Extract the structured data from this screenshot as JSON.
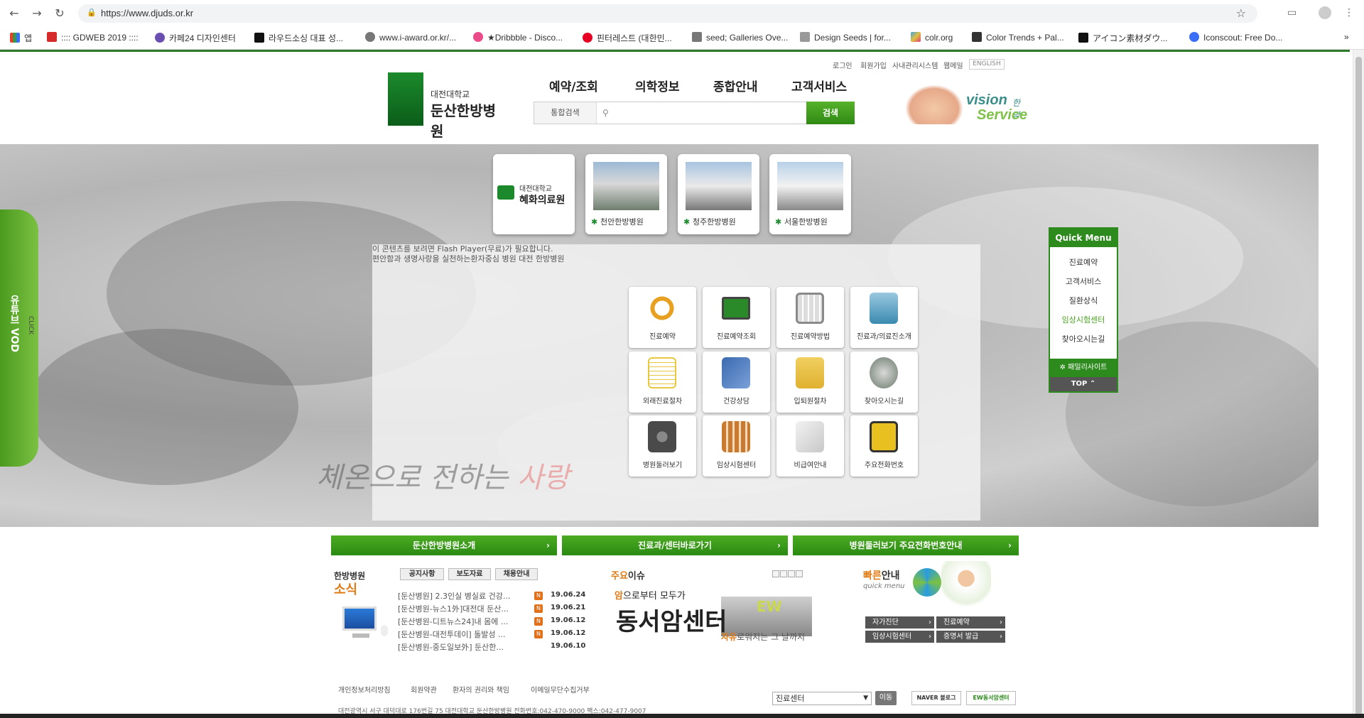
{
  "browser": {
    "url": "https://www.djuds.or.kr",
    "bookmarks": [
      {
        "label": "앱",
        "color": "#e3402e"
      },
      {
        "label": ":::: GDWEB 2019 ::::",
        "color": "#d62b2b"
      },
      {
        "label": "카페24 디자인센터",
        "color": "#6b4fb0"
      },
      {
        "label": "라우드소싱 대표 성...",
        "color": "#111111"
      },
      {
        "label": "www.i-award.or.kr/...",
        "color": "#555555"
      },
      {
        "label": "★Dribbble - Disco...",
        "color": "#ea4c89"
      },
      {
        "label": "핀터레스트 (대한민...",
        "color": "#e60023"
      },
      {
        "label": "seed; Galleries Ove...",
        "color": "#777777"
      },
      {
        "label": "Design Seeds | for...",
        "color": "#999999"
      },
      {
        "label": "colr.org",
        "color": "#3fa0e0"
      },
      {
        "label": "Color Trends + Pal...",
        "color": "#333333"
      },
      {
        "label": "アイコン素材ダウ...",
        "color": "#111111"
      },
      {
        "label": "Iconscout: Free Do...",
        "color": "#3b6ef6"
      }
    ]
  },
  "util": {
    "login": "로그인",
    "join": "회원가입",
    "intranet": "사내관리시스템",
    "webmail": "웹메일",
    "english": "ENGLISH"
  },
  "logo": {
    "line1": "대전대학교",
    "line2": "둔산한방병원"
  },
  "gnb": [
    "예약/조회",
    "의학정보",
    "종합안내",
    "고객서비스"
  ],
  "search": {
    "scope": "통합검색",
    "button": "검색",
    "value": ""
  },
  "vision": {
    "word1": "vision",
    "word1b": "한방",
    "word2": "Service"
  },
  "vod": {
    "label": "유튜브 VOD",
    "click": "CLICK"
  },
  "branches": [
    {
      "pre": "대전대학교",
      "name": "혜화의료원"
    },
    {
      "name": "천안한방병원"
    },
    {
      "name": "청주한방병원"
    },
    {
      "name": "서울한방병원"
    }
  ],
  "flash": {
    "line1": "이 콘텐츠를 보려면 Flash Player(무료)가 필요합니다.",
    "line2": "편안함과 생명사랑을 실천하는환자중심 병원 대전 한방병원"
  },
  "services": [
    {
      "label": "진료예약",
      "color": "#e8a020"
    },
    {
      "label": "진료예약조회",
      "color": "#2a8a2a"
    },
    {
      "label": "진료예약방법",
      "color": "#8a8a8a"
    },
    {
      "label": "진료과/의료진소개",
      "color": "#3a8ab0"
    },
    {
      "label": "외래진료절차",
      "color": "#e8c840"
    },
    {
      "label": "건강상담",
      "color": "#3a6ab0"
    },
    {
      "label": "입퇴원절차",
      "color": "#e0b030"
    },
    {
      "label": "찾아오시는길",
      "color": "#6a7a6a"
    },
    {
      "label": "병원둘러보기",
      "color": "#4a4a4a"
    },
    {
      "label": "임상시험센터",
      "color": "#c87a30"
    },
    {
      "label": "비급여안내",
      "color": "#d0d0d0"
    },
    {
      "label": "주요전화번호",
      "color": "#e8c020"
    }
  ],
  "slogan": {
    "main": "체온으로 전하는 ",
    "accent": "사랑"
  },
  "quick": {
    "title": "Quick Menu",
    "items": [
      "진료예약",
      "고객서비스",
      "질환상식",
      "임상시험센터",
      "찾아오시는길"
    ],
    "family": "패밀리사이트",
    "top": "TOP ⌃"
  },
  "bars": [
    "둔산한방병원소개",
    "진료과/센터바로가기",
    "병원둘러보기 주요전화번호안내"
  ],
  "news": {
    "heading1": "한방병원",
    "heading2": "소식",
    "tabs": [
      "공지사항",
      "보도자료",
      "채용안내"
    ],
    "items": [
      {
        "title": "[둔산병원] 2.3인실 병실료 건강...",
        "date": "19.06.24"
      },
      {
        "title": "[둔산병원-뉴스1外]대전대 둔산...",
        "date": "19.06.21"
      },
      {
        "title": "[둔산병원-디트뉴스24]내 몸에 ...",
        "date": "19.06.12"
      },
      {
        "title": "[둔산병원-대전투데이] 돌발성 ...",
        "date": "19.06.12"
      },
      {
        "title": "[둔산병원-중도일보外] 둔산한...",
        "date": "19.06.10"
      }
    ]
  },
  "issue": {
    "heading1": "주요",
    "heading2": "이슈",
    "line1a": "암",
    "line1b": "으로부터 모두가",
    "title": "동서암센터",
    "ew": "EW",
    "line3a": "자유",
    "line3b": "로워지는 그 날까지"
  },
  "fast": {
    "heading1": "빠른",
    "heading2": "안내",
    "sub": "quick menu",
    "buttons": [
      "자가진단",
      "진료예약",
      "임상시험센터",
      "증명서 발급"
    ]
  },
  "footer": {
    "links": [
      "개인정보처리방침",
      "회원약관",
      "환자의 권리와 책임",
      "이메일무단수집거부"
    ],
    "address": "대전광역시 서구 대덕대로 176번길 75 대전대학교 둔산한방병원  전화번호:042-470-9000 팩스:042-477-9007",
    "select_value": "진료센터",
    "move": "이동",
    "blog": "NAVER 블로그",
    "cancer": "EW동서암센터"
  }
}
